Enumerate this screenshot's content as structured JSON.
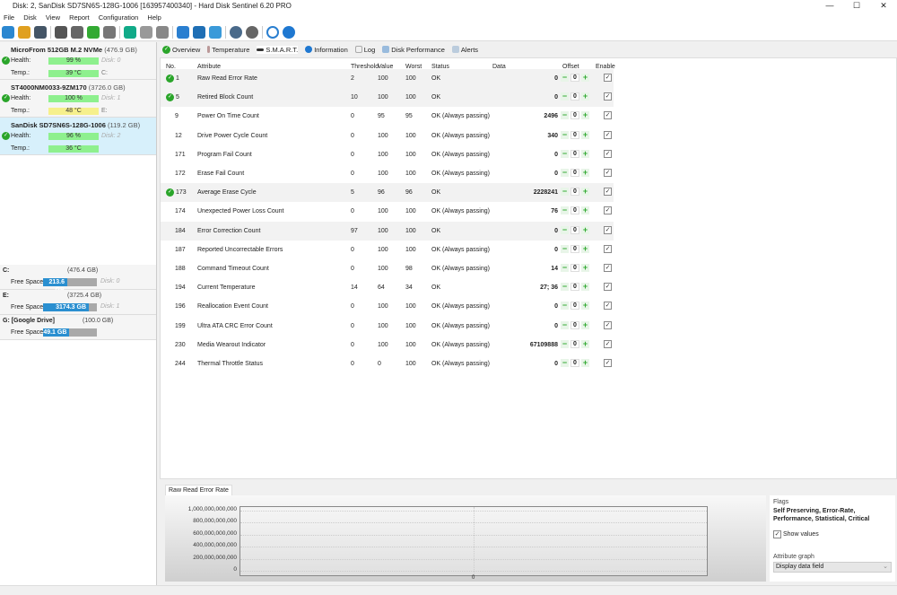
{
  "window": {
    "title": "Disk: 2, SanDisk SD7SN6S-128G-1006 [163957400340]  -  Hard Disk Sentinel 6.20 PRO",
    "min": "—",
    "max": "☐",
    "close": "✕"
  },
  "menu": [
    "File",
    "Disk",
    "View",
    "Report",
    "Configuration",
    "Help"
  ],
  "disks": [
    {
      "name": "MicroFrom 512GB M.2 NVMe",
      "size": "(476.9 GB)",
      "health_label": "Health:",
      "health": "99 %",
      "health_pct": 99,
      "temp_label": "Temp.:",
      "temp": "39 °C",
      "disk": "Disk: 0",
      "drive": "C:",
      "temp_color": "green"
    },
    {
      "name": "ST4000NM0033-9ZM170",
      "size": "(3726.0 GB)",
      "health_label": "Health:",
      "health": "100 %",
      "health_pct": 100,
      "temp_label": "Temp.:",
      "temp": "48 °C",
      "disk": "Disk: 1",
      "drive": "E:",
      "temp_color": "yellow"
    },
    {
      "name": "SanDisk SD7SN6S-128G-1006",
      "size": "(119.2 GB)",
      "health_label": "Health:",
      "health": "96 %",
      "health_pct": 96,
      "temp_label": "Temp.:",
      "temp": "36 °C",
      "disk": "Disk: 2",
      "drive": "",
      "temp_color": "green"
    }
  ],
  "drives": [
    {
      "name": "C:",
      "cap": "(476.4 GB)",
      "fs_label": "Free Space",
      "free": "213.6 GB",
      "free_pct": 45,
      "disk": "Disk: 0"
    },
    {
      "name": "E:",
      "cap": "(3725.4 GB)",
      "fs_label": "Free Space",
      "free": "3174.3 GB",
      "free_pct": 85,
      "disk": "Disk: 1"
    },
    {
      "name": "G: [Google Drive]",
      "cap": "(100.0 GB)",
      "fs_label": "Free Space",
      "free": "49.1 GB",
      "free_pct": 49,
      "disk": ""
    }
  ],
  "tabs": [
    "Overview",
    "Temperature",
    "S.M.A.R.T.",
    "Information",
    "Log",
    "Disk Performance",
    "Alerts"
  ],
  "smart": {
    "headers": {
      "no": "No.",
      "attr": "Attribute",
      "thr": "Threshold",
      "val": "Value",
      "worst": "Worst",
      "status": "Status",
      "data": "Data",
      "offset": "Offset",
      "enable": "Enable"
    },
    "rows": [
      {
        "no": "1",
        "attr": "Raw Read Error Rate",
        "thr": "2",
        "val": "100",
        "worst": "100",
        "status": "OK",
        "data": "0",
        "offset": "0",
        "ok": true
      },
      {
        "no": "5",
        "attr": "Retired Block Count",
        "thr": "10",
        "val": "100",
        "worst": "100",
        "status": "OK",
        "data": "0",
        "offset": "0",
        "ok": true
      },
      {
        "no": "9",
        "attr": "Power On Time Count",
        "thr": "0",
        "val": "95",
        "worst": "95",
        "status": "OK (Always passing)",
        "data": "2496",
        "offset": "0",
        "ok": false
      },
      {
        "no": "12",
        "attr": "Drive Power Cycle Count",
        "thr": "0",
        "val": "100",
        "worst": "100",
        "status": "OK (Always passing)",
        "data": "340",
        "offset": "0",
        "ok": false
      },
      {
        "no": "171",
        "attr": "Program Fail Count",
        "thr": "0",
        "val": "100",
        "worst": "100",
        "status": "OK (Always passing)",
        "data": "0",
        "offset": "0",
        "ok": false
      },
      {
        "no": "172",
        "attr": "Erase Fail Count",
        "thr": "0",
        "val": "100",
        "worst": "100",
        "status": "OK (Always passing)",
        "data": "0",
        "offset": "0",
        "ok": false
      },
      {
        "no": "173",
        "attr": "Average Erase Cycle",
        "thr": "5",
        "val": "96",
        "worst": "96",
        "status": "OK",
        "data": "2228241",
        "offset": "0",
        "ok": true
      },
      {
        "no": "174",
        "attr": "Unexpected Power Loss Count",
        "thr": "0",
        "val": "100",
        "worst": "100",
        "status": "OK (Always passing)",
        "data": "76",
        "offset": "0",
        "ok": false
      },
      {
        "no": "184",
        "attr": "Error Correction Count",
        "thr": "97",
        "val": "100",
        "worst": "100",
        "status": "OK",
        "data": "0",
        "offset": "0",
        "ok": false,
        "shade": true
      },
      {
        "no": "187",
        "attr": "Reported Uncorrectable Errors",
        "thr": "0",
        "val": "100",
        "worst": "100",
        "status": "OK (Always passing)",
        "data": "0",
        "offset": "0",
        "ok": false
      },
      {
        "no": "188",
        "attr": "Command Timeout Count",
        "thr": "0",
        "val": "100",
        "worst": "98",
        "status": "OK (Always passing)",
        "data": "14",
        "offset": "0",
        "ok": false
      },
      {
        "no": "194",
        "attr": "Current Temperature",
        "thr": "14",
        "val": "64",
        "worst": "34",
        "status": "OK",
        "data": "27; 36",
        "offset": "0",
        "ok": false
      },
      {
        "no": "196",
        "attr": "Reallocation Event Count",
        "thr": "0",
        "val": "100",
        "worst": "100",
        "status": "OK (Always passing)",
        "data": "0",
        "offset": "0",
        "ok": false
      },
      {
        "no": "199",
        "attr": "Ultra ATA CRC Error Count",
        "thr": "0",
        "val": "100",
        "worst": "100",
        "status": "OK (Always passing)",
        "data": "0",
        "offset": "0",
        "ok": false
      },
      {
        "no": "230",
        "attr": "Media Wearout Indicator",
        "thr": "0",
        "val": "100",
        "worst": "100",
        "status": "OK (Always passing)",
        "data": "67109888",
        "offset": "0",
        "ok": false
      },
      {
        "no": "244",
        "attr": "Thermal Throttle Status",
        "thr": "0",
        "val": "0",
        "worst": "100",
        "status": "OK (Always passing)",
        "data": "0",
        "offset": "0",
        "ok": false
      }
    ]
  },
  "graph": {
    "tab": "Raw Read Error Rate",
    "yticks": [
      "1,000,000,000,000",
      "800,000,000,000",
      "600,000,000,000",
      "400,000,000,000",
      "200,000,000,000",
      "0"
    ],
    "xtick": "0"
  },
  "flags": {
    "label": "Flags",
    "value": "Self Preserving, Error-Rate, Performance, Statistical, Critical",
    "show_values": "Show values",
    "attr_graph_label": "Attribute graph",
    "attr_graph_value": "Display data field"
  }
}
